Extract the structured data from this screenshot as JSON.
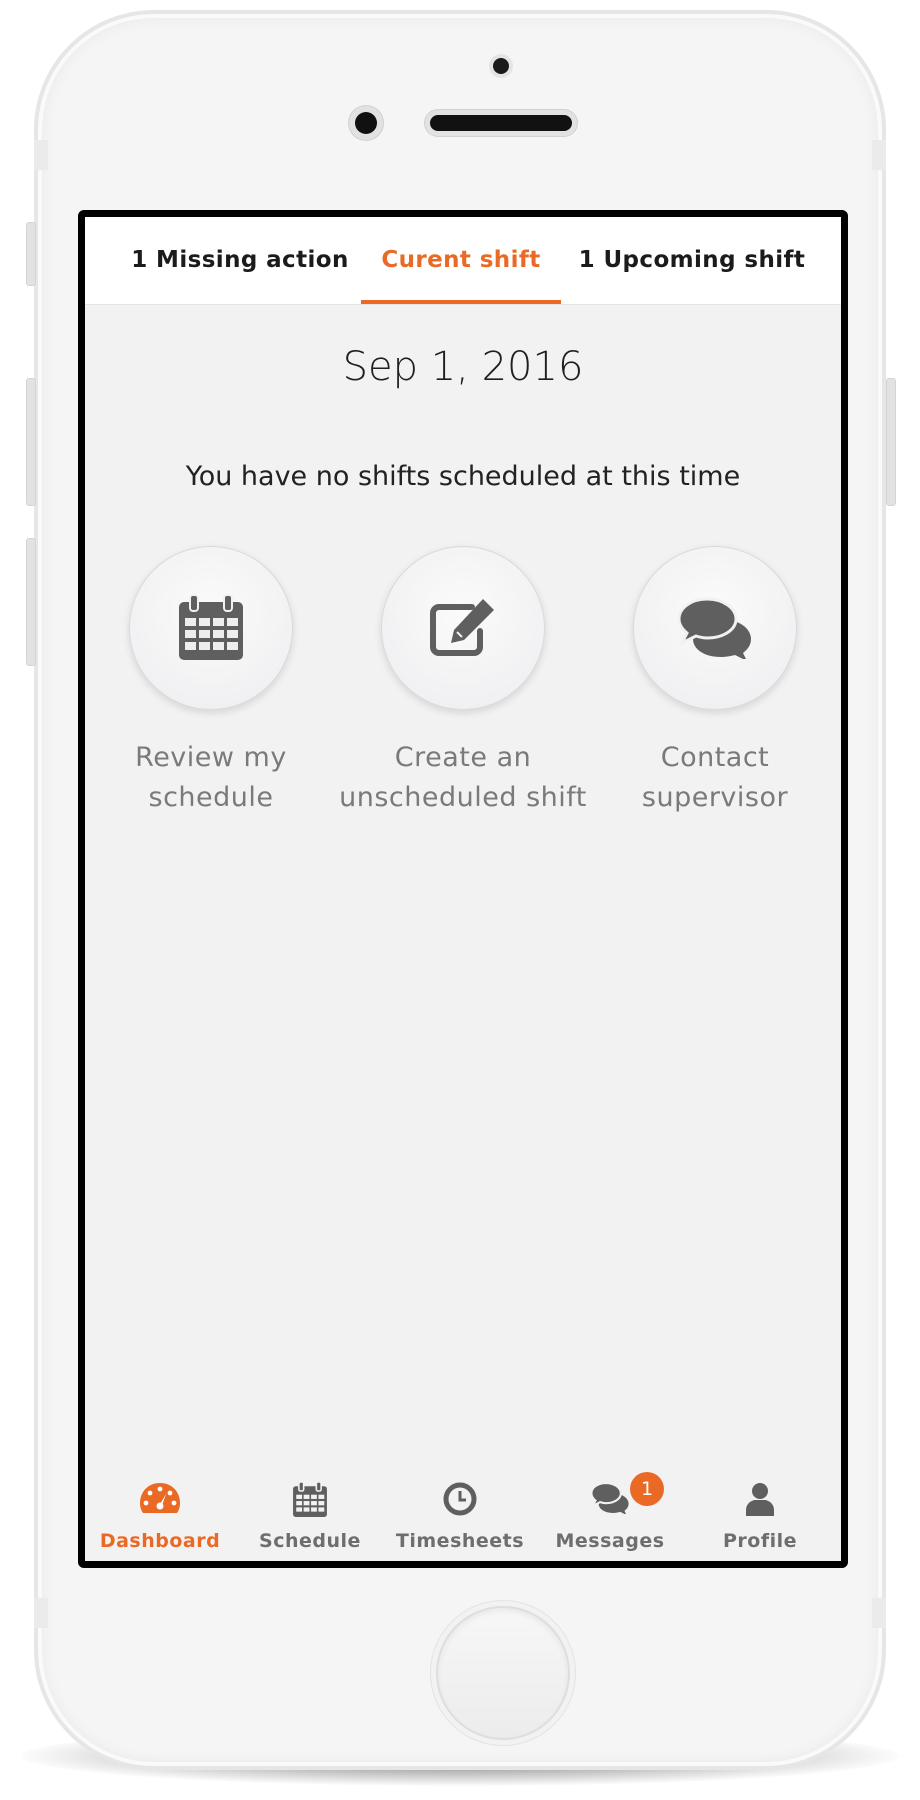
{
  "tabs": {
    "missing": "1 Missing action",
    "current": "Curent shift",
    "upcoming": "1 Upcoming shift",
    "active": "current"
  },
  "main": {
    "date": "Sep 1, 2016",
    "message": "You have no shifts scheduled at this time",
    "actions": [
      {
        "line1": "Review my",
        "line2": "schedule",
        "icon": "calendar-icon"
      },
      {
        "line1": "Create an",
        "line2": "unscheduled shift",
        "icon": "edit-icon"
      },
      {
        "line1": "Contact",
        "line2": "supervisor",
        "icon": "chat-icon"
      }
    ]
  },
  "nav": {
    "items": [
      {
        "label": "Dashboard",
        "icon": "dashboard-icon",
        "active": true
      },
      {
        "label": "Schedule",
        "icon": "calendar-icon"
      },
      {
        "label": "Timesheets",
        "icon": "clock-icon"
      },
      {
        "label": "Messages",
        "icon": "messages-icon",
        "badge": "1"
      },
      {
        "label": "Profile",
        "icon": "person-icon"
      }
    ]
  },
  "colors": {
    "accent": "#ea6a25",
    "icon": "#5f5f5f",
    "label": "#7a7a7a",
    "background": "#f2f2f2"
  }
}
